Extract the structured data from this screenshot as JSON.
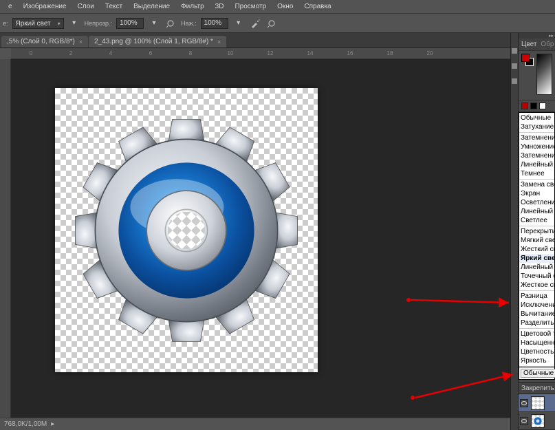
{
  "menubar": [
    "е",
    "Изображение",
    "Слои",
    "Текст",
    "Выделение",
    "Фильтр",
    "3D",
    "Просмотр",
    "Окно",
    "Справка"
  ],
  "optbar": {
    "first_label": "е:",
    "blend_combo": "Яркий свет",
    "opacity_label": "Непрозр.:",
    "opacity_value": "100%",
    "flow_label": "Наж.:",
    "flow_value": "100%"
  },
  "tabs": [
    {
      "label": ",5% (Слой 0, RGB/8*)",
      "active": false
    },
    {
      "label": "2_43.png @ 100% (Слой 1, RGB/8#) *",
      "active": true
    }
  ],
  "ruler_ticks": [
    "0",
    "2",
    "4",
    "6",
    "8",
    "10",
    "12",
    "14",
    "16",
    "18",
    "20"
  ],
  "statusbar": "768,0K/1,00M",
  "panels": {
    "color_tab1": "Цвет",
    "color_tab2": "Обр"
  },
  "blend_modes": [
    {
      "group": [
        "Обычные",
        "Затухание"
      ]
    },
    {
      "group": [
        "Затемнение",
        "Умножение",
        "Затемнение о",
        "Линейный за",
        "Темнее"
      ]
    },
    {
      "group": [
        "Замена светл",
        "Экран",
        "Осветление о",
        "Линейный ос",
        "Светлее"
      ]
    },
    {
      "group": [
        "Перекрытие",
        "Мягкий свет",
        "Жесткий све",
        "Яркий свет",
        "Линейный св",
        "Точечный св",
        "Жесткое сме"
      ]
    },
    {
      "group": [
        "Разница",
        "Исключение",
        "Вычитание",
        "Разделить"
      ]
    },
    {
      "group": [
        "Цветовой то",
        "Насыщеннос",
        "Цветность",
        "Яркость"
      ]
    }
  ],
  "blend_selected": "Яркий свет",
  "blend_footer_btn": "Обычные",
  "lock_label": "Закрепить:"
}
